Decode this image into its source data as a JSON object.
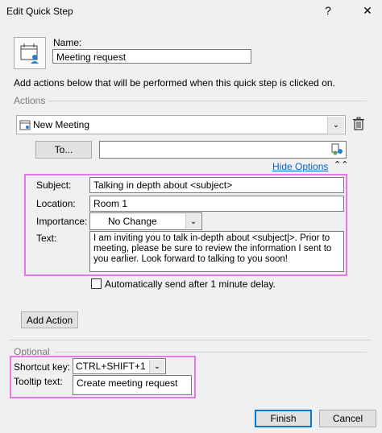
{
  "window": {
    "title": "Edit Quick Step",
    "help_label": "?",
    "close_label": "✕"
  },
  "name_section": {
    "label": "Name:",
    "value": "Meeting request"
  },
  "instructions": "Add actions below that will be performed when this quick step is clicked on.",
  "actions_group": {
    "label": "Actions",
    "action_select": "New Meeting",
    "to_button": "To...",
    "to_value": "",
    "hide_options": "Hide Options",
    "subject_label": "Subject:",
    "subject_value": "Talking in depth about <subject>",
    "location_label": "Location:",
    "location_value": "Room 1",
    "importance_label": "Importance:",
    "importance_value": "No Change",
    "text_label": "Text:",
    "text_value": "I am inviting you to talk in-depth about <subject|>. Prior to meeting, please be sure to review the information I sent to you earlier. Look forward to talking to you soon!",
    "auto_send_label": "Automatically send after 1 minute delay.",
    "auto_send_checked": false
  },
  "add_action_button": "Add Action",
  "optional_group": {
    "label": "Optional",
    "shortcut_label": "Shortcut key:",
    "shortcut_value": "CTRL+SHIFT+1",
    "tooltip_label": "Tooltip text:",
    "tooltip_value": "Create meeting request"
  },
  "footer": {
    "finish_label": "Finish",
    "cancel_label": "Cancel"
  },
  "colors": {
    "highlight": "#e878e8",
    "link": "#0066cc",
    "accent": "#0078d7"
  }
}
